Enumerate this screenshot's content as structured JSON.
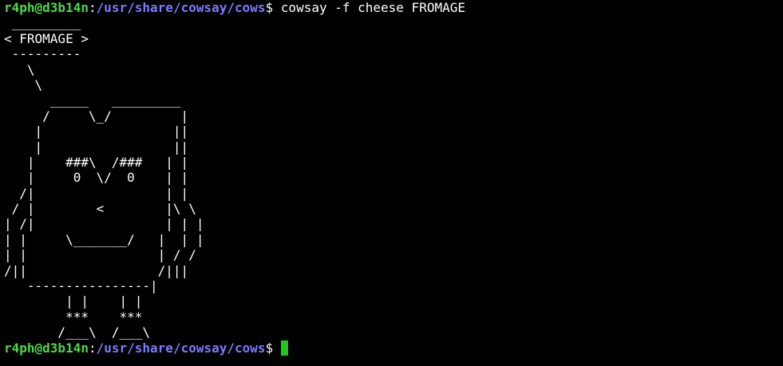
{
  "prompt": {
    "user_host": "r4ph@d3b14n",
    "colon": ":",
    "path": "/usr/share/cowsay/cows",
    "symbol": "$ "
  },
  "command": "cowsay -f cheese FROMAGE",
  "output_lines": [
    " _________",
    "< FROMAGE >",
    " ---------",
    "   \\",
    "    \\",
    "      _____   _________",
    "     /     \\_/         |",
    "    |                 ||",
    "    |                 ||",
    "   |    ###\\  /###   | |",
    "   |     0  \\/  0    | |",
    "  /|                 | |",
    " / |        <        |\\ \\",
    "| /|                 | | |",
    "| |     \\_______/   |  | |",
    "| |                 | / /",
    "/||                 /|||",
    "   ----------------|",
    "        | |    | |",
    "        ***    ***",
    "       /___\\  /___\\"
  ],
  "colors": {
    "background": "#000000",
    "user_host": "#4ed848",
    "path": "#7b7bff",
    "text": "#ffffff",
    "cursor": "#22c522"
  }
}
